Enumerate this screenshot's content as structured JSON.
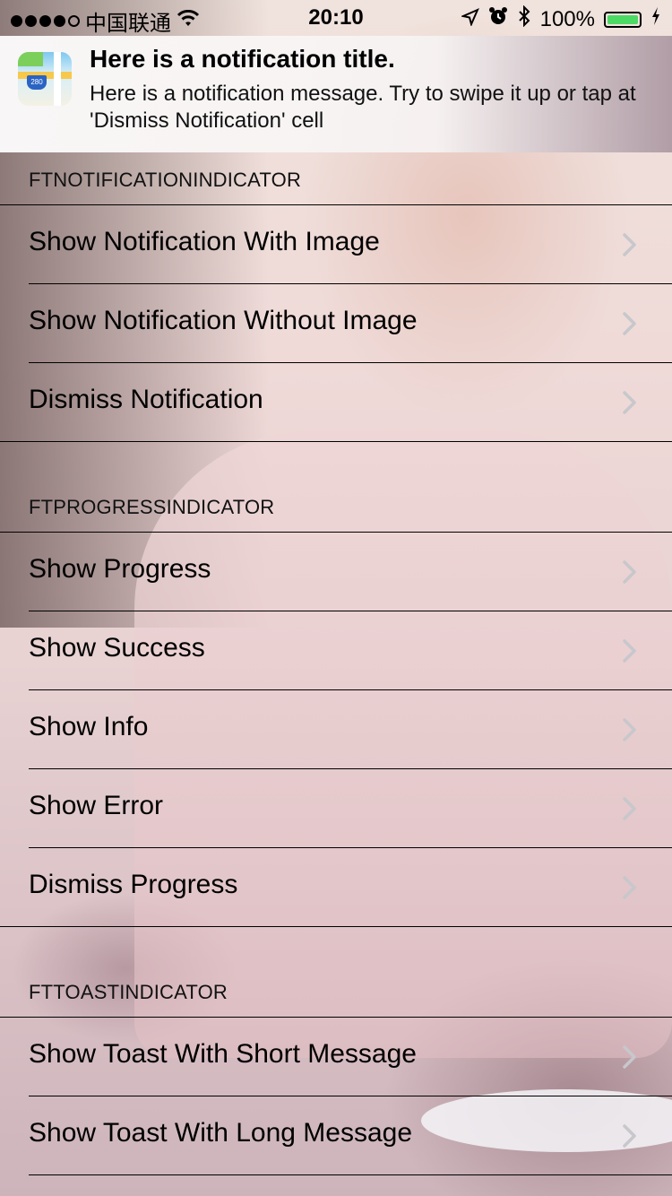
{
  "status_bar": {
    "carrier": "中国联通",
    "time": "20:10",
    "battery_percent": "100%",
    "battery_level": 1.0,
    "signal_bars_filled": 4,
    "signal_bars_total": 5
  },
  "notification": {
    "title": "Here is a notification title.",
    "message": "Here is a notification message. Try to swipe it up or tap at 'Dismiss Notification' cell",
    "app_icon": "maps-icon"
  },
  "sections": [
    {
      "header": "FTNOTIFICATIONINDICATOR",
      "rows": [
        {
          "label": "Show Notification With Image"
        },
        {
          "label": "Show Notification Without Image"
        },
        {
          "label": "Dismiss Notification"
        }
      ]
    },
    {
      "header": "FTPROGRESSINDICATOR",
      "rows": [
        {
          "label": "Show Progress"
        },
        {
          "label": "Show Success"
        },
        {
          "label": "Show Info"
        },
        {
          "label": "Show Error"
        },
        {
          "label": "Dismiss Progress"
        }
      ]
    },
    {
      "header": "FTTOASTINDICATOR",
      "rows": [
        {
          "label": "Show Toast With Short Message"
        },
        {
          "label": "Show Toast With Long Message"
        }
      ]
    }
  ],
  "colors": {
    "battery_fill": "#4cd964",
    "chevron": "#c7c7cc"
  }
}
